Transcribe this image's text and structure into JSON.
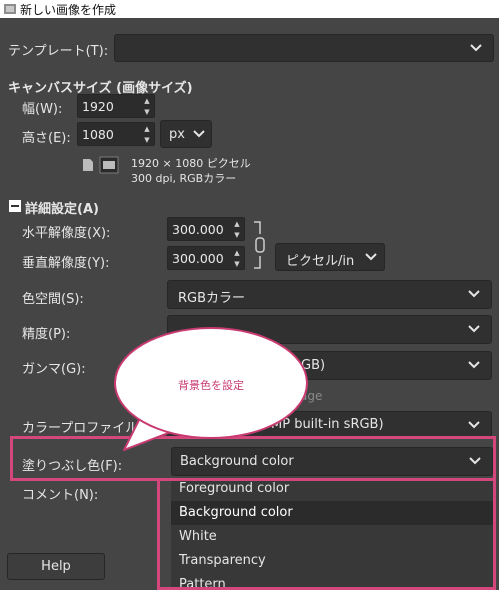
{
  "window": {
    "title": "新しい画像を作成"
  },
  "template": {
    "label": "テンプレート(T):",
    "value": ""
  },
  "canvas_size": {
    "heading": "キャンバスサイズ (画像サイズ)",
    "width_label": "幅(W):",
    "width_value": "1920",
    "height_label": "高さ(E):",
    "height_value": "1080",
    "unit": "px",
    "info_line1": "1920 × 1080 ピクセル",
    "info_line2": "300 dpi, RGBカラー"
  },
  "advanced": {
    "heading": "詳細設定(A)",
    "xres_label": "水平解像度(X):",
    "xres_value": "300.000",
    "yres_label": "垂直解像度(Y):",
    "yres_value": "300.000",
    "res_unit": "ピクセル/in",
    "colorspace_label": "色空間(S):",
    "colorspace_value": "RGBカラー",
    "precision_label": "精度(P):",
    "precision_value": "",
    "gamma_label": "ガンマ(G):",
    "gamma_value_fragment": "GB)",
    "gamma_note_fragment": "age",
    "profile_label": "カラープロファイル(L)",
    "profile_value_fragment": "MP built-in sRGB)",
    "fill_label": "塗りつぶし色(F):",
    "fill_value": "Background color",
    "comment_label": "コメント(N):"
  },
  "fill_options": [
    "Foreground color",
    "Background color",
    "White",
    "Transparency",
    "Pattern"
  ],
  "selected_fill_index": 1,
  "buttons": {
    "help": "Help"
  },
  "annotation": {
    "text": "背景色を設定",
    "color": "#d4477d"
  }
}
